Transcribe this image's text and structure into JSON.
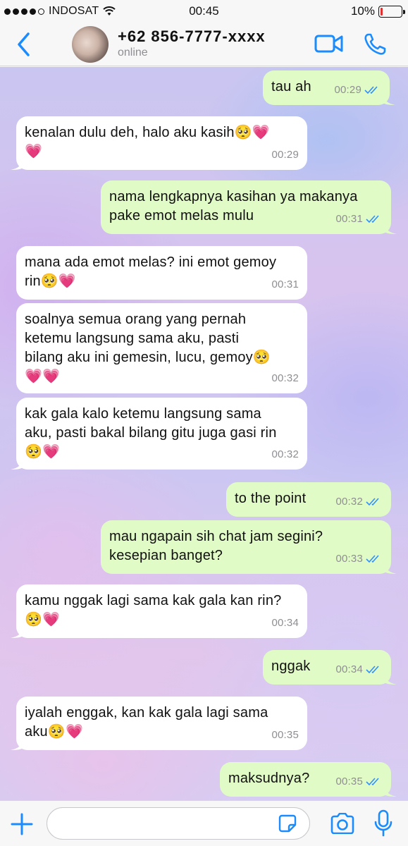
{
  "status_bar": {
    "carrier": "INDOSAT",
    "time": "00:45",
    "battery": "10%",
    "battery_level": 0.1
  },
  "header": {
    "contact_name": "+62 856-7777-xxxx",
    "contact_status": "online",
    "accent_color": "#1a8cff"
  },
  "messages": [
    {
      "direction": "out",
      "text": "tau ah",
      "time": "00:29",
      "read": true
    },
    {
      "direction": "in",
      "text": "kenalan dulu deh, halo aku kasih🥺💗\n💗",
      "time": "00:29"
    },
    {
      "direction": "out",
      "text": "nama lengkapnya kasihan ya makanya\npake emot melas mulu",
      "time": "00:31",
      "read": true
    },
    {
      "direction": "in",
      "text": "mana ada emot melas? ini emot gemoy\nrin🥺💗",
      "time": "00:31"
    },
    {
      "direction": "in",
      "text": "soalnya semua orang yang pernah\nketemu langsung sama aku, pasti\nbilang aku ini gemesin, lucu, gemoy🥺\n💗💗",
      "time": "00:32"
    },
    {
      "direction": "in",
      "text": "kak gala kalo ketemu langsung sama\naku, pasti bakal bilang gitu juga gasi rin\n🥺💗",
      "time": "00:32"
    },
    {
      "direction": "out",
      "text": "to the point",
      "time": "00:32",
      "read": true
    },
    {
      "direction": "out",
      "text": "mau ngapain sih chat jam segini?\nkesepian banget?",
      "time": "00:33",
      "read": true
    },
    {
      "direction": "in",
      "text": "kamu nggak lagi sama kak gala kan rin?\n🥺💗",
      "time": "00:34"
    },
    {
      "direction": "out",
      "text": "nggak",
      "time": "00:34",
      "read": true
    },
    {
      "direction": "in",
      "text": "iyalah enggak, kan kak gala lagi sama\naku🥺💗",
      "time": "00:35"
    },
    {
      "direction": "out",
      "text": "maksudnya?",
      "time": "00:35",
      "read": true
    }
  ],
  "input_bar": {
    "placeholder": ""
  }
}
